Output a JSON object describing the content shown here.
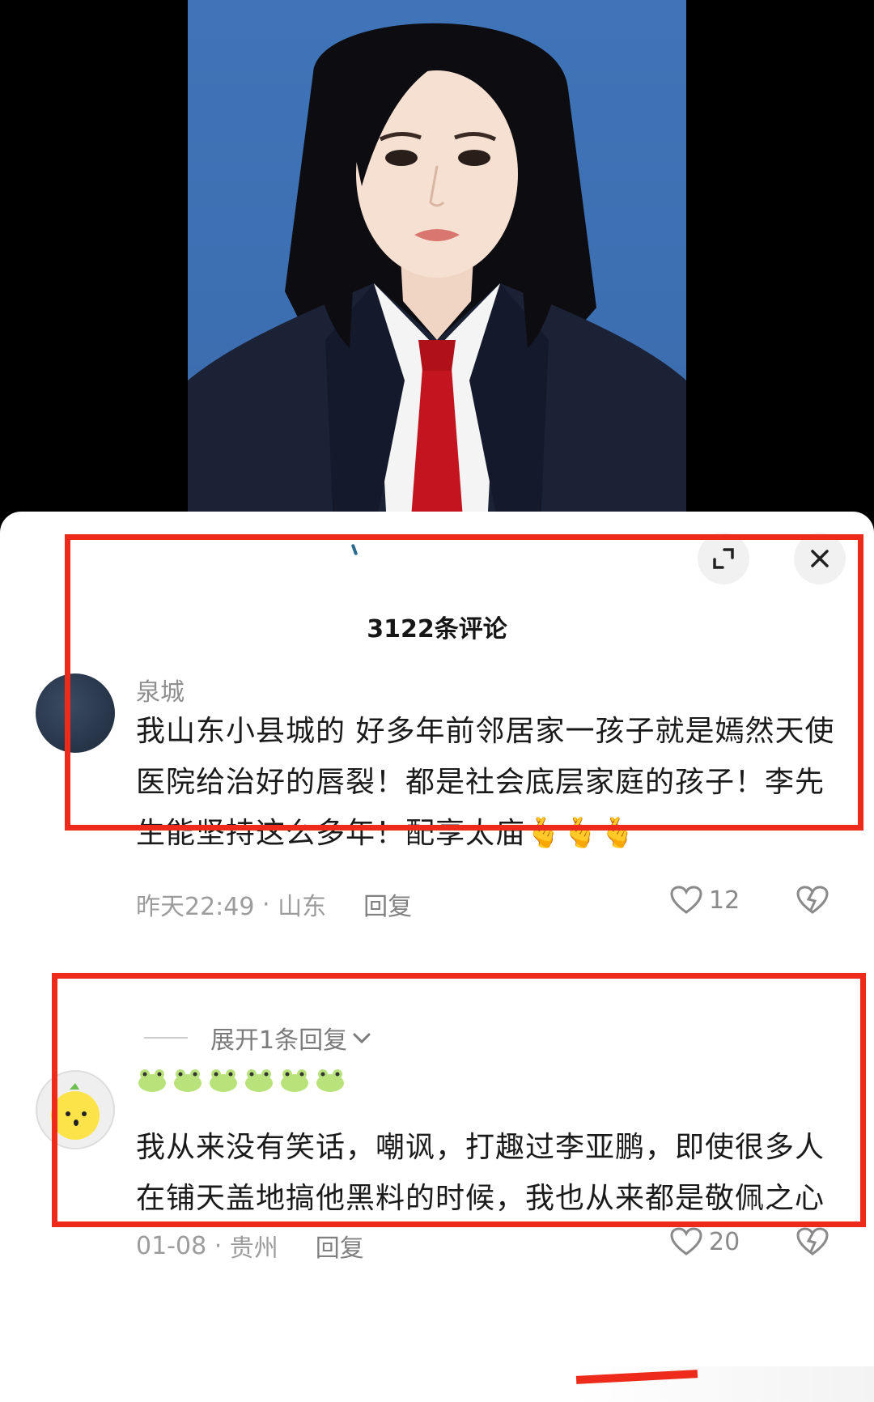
{
  "header": {
    "comment_count": "3122条评论"
  },
  "comments": [
    {
      "username": "泉城",
      "text": "我山东小县城的  好多年前邻居家一孩子就是嫣然天使医院给治好的唇裂！都是社会底层家庭的孩子！李先生能坚持这么多年！配享太庙🫰🫰🫰",
      "time": "昨天22:49",
      "location": "山东",
      "reply_label": "回复",
      "likes": "12",
      "expand_replies": "展开1条回复"
    },
    {
      "username_icons": [
        "frog-emoji",
        "frog-emoji",
        "frog-emoji",
        "frog-emoji",
        "frog-emoji",
        "frog-emoji"
      ],
      "text": "我从来没有笑话，嘲讽，打趣过李亚鹏，即使很多人在铺天盖地搞他黑料的时候，我也从来都是敬佩之心",
      "time": "01-08",
      "location": "贵州",
      "reply_label": "回复",
      "likes": "20"
    }
  ],
  "icons": {
    "expand": "expand-icon",
    "close": "close-icon",
    "like": "heart-icon",
    "dislike": "broken-heart-icon",
    "chevron": "chevron-down-icon"
  },
  "colors": {
    "highlight_box": "#ee2a1a",
    "photo_background": "#3f74b8"
  }
}
